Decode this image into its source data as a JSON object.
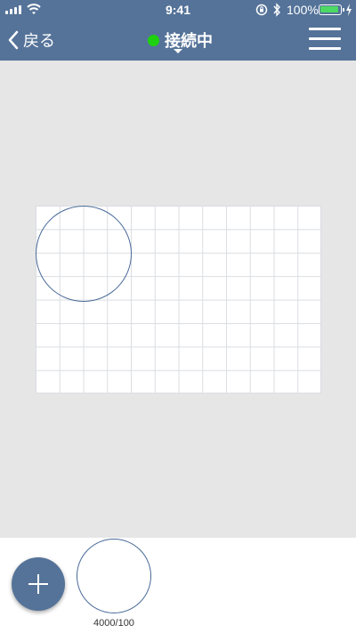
{
  "status_bar": {
    "time": "9:41",
    "battery_percent": "100%",
    "battery_level": 1.0
  },
  "nav": {
    "back_label": "戻る",
    "connection_label": "接続中",
    "connection_color": "#1ed10f",
    "accent_color": "#557399"
  },
  "canvas": {
    "shape": "circle"
  },
  "toolbar": {
    "add_icon": "plus-icon",
    "thumbnail_label": "4000/100"
  }
}
